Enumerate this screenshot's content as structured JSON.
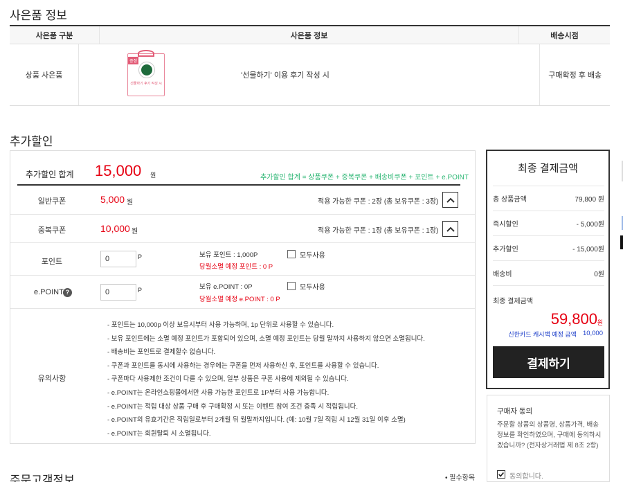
{
  "gift": {
    "title": "사은품 정보",
    "headers": [
      "사은품 구분",
      "사은품 정보",
      "배송시점"
    ],
    "row": {
      "type": "상품 사은품",
      "info": "'선물하기' 이용 후기 작성 시",
      "delivery": "구매확정 후 배송",
      "img_tag": "증정",
      "img_caption": "선물하기 후기 작성 시"
    }
  },
  "discount": {
    "title": "추가할인",
    "total_label": "추가할인 합계",
    "total_value": "15,000",
    "total_unit": "원",
    "formula": "추가할인 합계 = 상품쿠폰 + 중복쿠폰 + 배송비쿠폰 + 포인트 + e.POINT",
    "general_coupon": {
      "label": "일반쿠폰",
      "value": "5,000",
      "unit": "원",
      "available": "적용 가능한 쿠폰 : 2장 (총 보유쿠폰 : 3장)"
    },
    "dup_coupon": {
      "label": "중복쿠폰",
      "value": "10,000",
      "unit": "원",
      "available": "적용 가능한 쿠폰 : 1장 (총 보유쿠폰 : 1장)"
    },
    "point": {
      "label": "포인트",
      "input_value": "0",
      "unit": "P",
      "have": "보유 포인트 : 1,000P",
      "expire": "당월소멸 예정 포인트 : 0 P",
      "use_all": "모두사용"
    },
    "epoint": {
      "label": "e.POINT",
      "help": "?",
      "input_value": "0",
      "unit": "P",
      "have": "보유 e.POINT : 0P",
      "expire": "당월소멸 예정 e.POINT : 0 P",
      "use_all": "모두사용"
    },
    "notice": {
      "label": "유의사항",
      "items": [
        "- 포인트는 10,000p 이상 보유시부터 사용 가능하며, 1p 단위로 사용할 수 있습니다.",
        "- 보유 포인트에는 소멸 예정 포인트가 포함되어 있으며, 소멸 예정 포인트는 당월 말까지 사용하지 않으면 소멸됩니다.",
        "- 배송비는 포인트로 결제할수 없습니다.",
        "- 쿠폰과 포인트를 동시에 사용하는 경우에는 쿠폰을 먼저 사용하신 후, 포인트를 사용할 수 있습니다.",
        "- 쿠폰마다 사용제한 조건이 다를 수 있으며, 일부 상품은 쿠폰 사용에 제외될 수 있습니다.",
        "- e.POINT는 온라인쇼핑몰에서만 사용 가능한 포인트로 1P부터 사용 가능합니다.",
        "- e.POINT는 적립 대상 상품 구매 후 구매확정 시 또는 이벤트 참여 조건 충족 시 적립됩니다.",
        "- e.POINT의 유효기간은 적립일로부터 2개월 뒤 월말까지입니다. (예: 10월 7일 적립 시 12월 31일 이후 소멸)",
        "- e.POINT는 회원탈퇴 시 소멸됩니다."
      ]
    }
  },
  "summary": {
    "title": "최종 결제금액",
    "rows": [
      {
        "label": "총 상품금액",
        "value": "79,800 원"
      },
      {
        "label": "즉시할인",
        "value": "- 5,000원"
      },
      {
        "label": "추가할인",
        "value": "- 15,000원"
      },
      {
        "label": "배송비",
        "value": "0원"
      }
    ],
    "final_label": "최종 결제금액",
    "final_value": "59,800",
    "final_unit": "원",
    "cashback_label": "신한카드 캐시백 예정 금액",
    "cashback_value": "10,000",
    "pay_button": "결제하기"
  },
  "agree": {
    "title": "구매자 동의",
    "text": "주문할 상품의 상품명, 상품가격, 배송정보를 확인하였으며, 구매에 동의하시겠습니까? (전자상거래법 제 8조 2항)",
    "check_label": "동의합니다."
  },
  "customer": {
    "title": "주문고객정보",
    "required": "• 필수항목"
  },
  "colors": {
    "accent_red": "#e60012",
    "formula_green": "#2bb673",
    "cashback_blue": "#1a3cc8",
    "button_dark": "#222222"
  }
}
